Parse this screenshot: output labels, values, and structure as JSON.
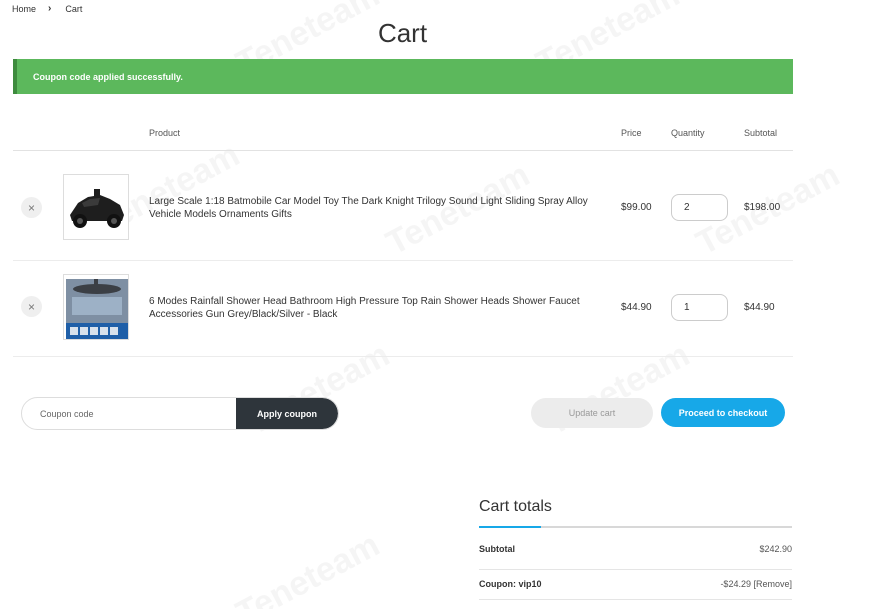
{
  "breadcrumb": {
    "home": "Home",
    "current": "Cart"
  },
  "page_title": "Cart",
  "notice": "Coupon code applied successfully.",
  "table": {
    "headers": {
      "product": "Product",
      "price": "Price",
      "quantity": "Quantity",
      "subtotal": "Subtotal"
    },
    "remove_symbol": "×",
    "items": [
      {
        "name": "Large Scale 1:18 Batmobile Car Model Toy The Dark Knight Trilogy Sound Light Sliding Spray Alloy Vehicle Models Ornaments Gifts",
        "price": "$99.00",
        "quantity": "2",
        "subtotal": "$198.00"
      },
      {
        "name": "6 Modes Rainfall Shower Head Bathroom High Pressure Top Rain Shower Heads Shower Faucet Accessories Gun Grey/Black/Silver - Black",
        "price": "$44.90",
        "quantity": "1",
        "subtotal": "$44.90"
      }
    ]
  },
  "coupon": {
    "placeholder": "Coupon code",
    "apply_label": "Apply coupon"
  },
  "actions": {
    "update_label": "Update cart",
    "checkout_label": "Proceed to checkout"
  },
  "totals": {
    "title": "Cart totals",
    "subtotal_label": "Subtotal",
    "subtotal_value": "$242.90",
    "coupon_label": "Coupon: vip10",
    "coupon_value": "-$24.29",
    "coupon_remove": "[Remove]"
  },
  "watermark": "Teneteam",
  "colors": {
    "notice": "#5cb85c",
    "checkout": "#17a8e8",
    "coupon_button": "#2e353b"
  }
}
